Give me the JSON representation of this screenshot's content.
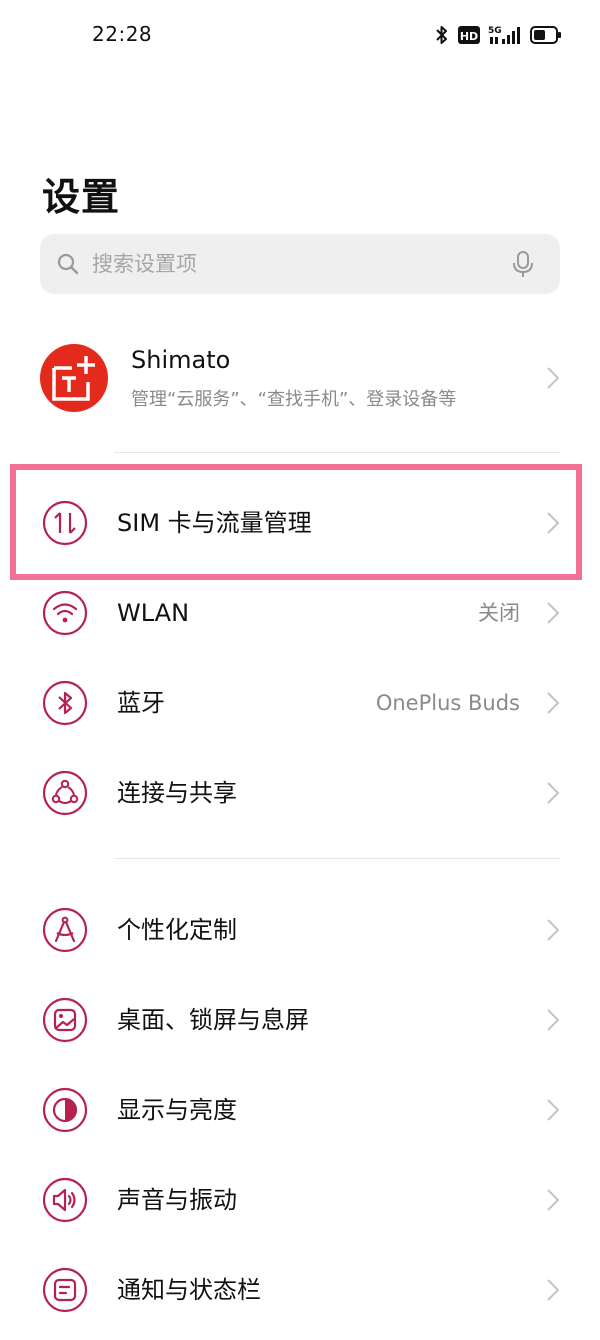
{
  "status_bar": {
    "time": "22:28",
    "icons": [
      "bluetooth-icon",
      "hd-icon",
      "5g-signal-icon",
      "battery-icon"
    ],
    "hd_label": "HD",
    "network_label": "5G"
  },
  "page": {
    "title": "设置"
  },
  "search": {
    "placeholder": "搜索设置项",
    "value": ""
  },
  "account": {
    "name": "Shimato",
    "subtitle": "管理“云服务”、“查找手机”、登录设备等"
  },
  "colors": {
    "accent": "#b5224f",
    "highlight": "#f27197",
    "avatar_bg": "#e42a1d"
  },
  "rows": [
    {
      "id": "sim",
      "label": "SIM 卡与流量管理",
      "value": "",
      "icon": "sim-data-icon"
    },
    {
      "id": "wlan",
      "label": "WLAN",
      "value": "关闭",
      "icon": "wifi-icon"
    },
    {
      "id": "bluetooth",
      "label": "蓝牙",
      "value": "OnePlus Buds",
      "icon": "bluetooth-icon"
    },
    {
      "id": "connect",
      "label": "连接与共享",
      "value": "",
      "icon": "share-icon"
    },
    {
      "id": "personalize",
      "label": "个性化定制",
      "value": "",
      "icon": "compass-icon"
    },
    {
      "id": "home",
      "label": "桌面、锁屏与息屏",
      "value": "",
      "icon": "wallpaper-icon"
    },
    {
      "id": "display",
      "label": "显示与亮度",
      "value": "",
      "icon": "brightness-icon"
    },
    {
      "id": "sound",
      "label": "声音与振动",
      "value": "",
      "icon": "speaker-icon"
    },
    {
      "id": "notify",
      "label": "通知与状态栏",
      "value": "",
      "icon": "notification-icon"
    }
  ]
}
